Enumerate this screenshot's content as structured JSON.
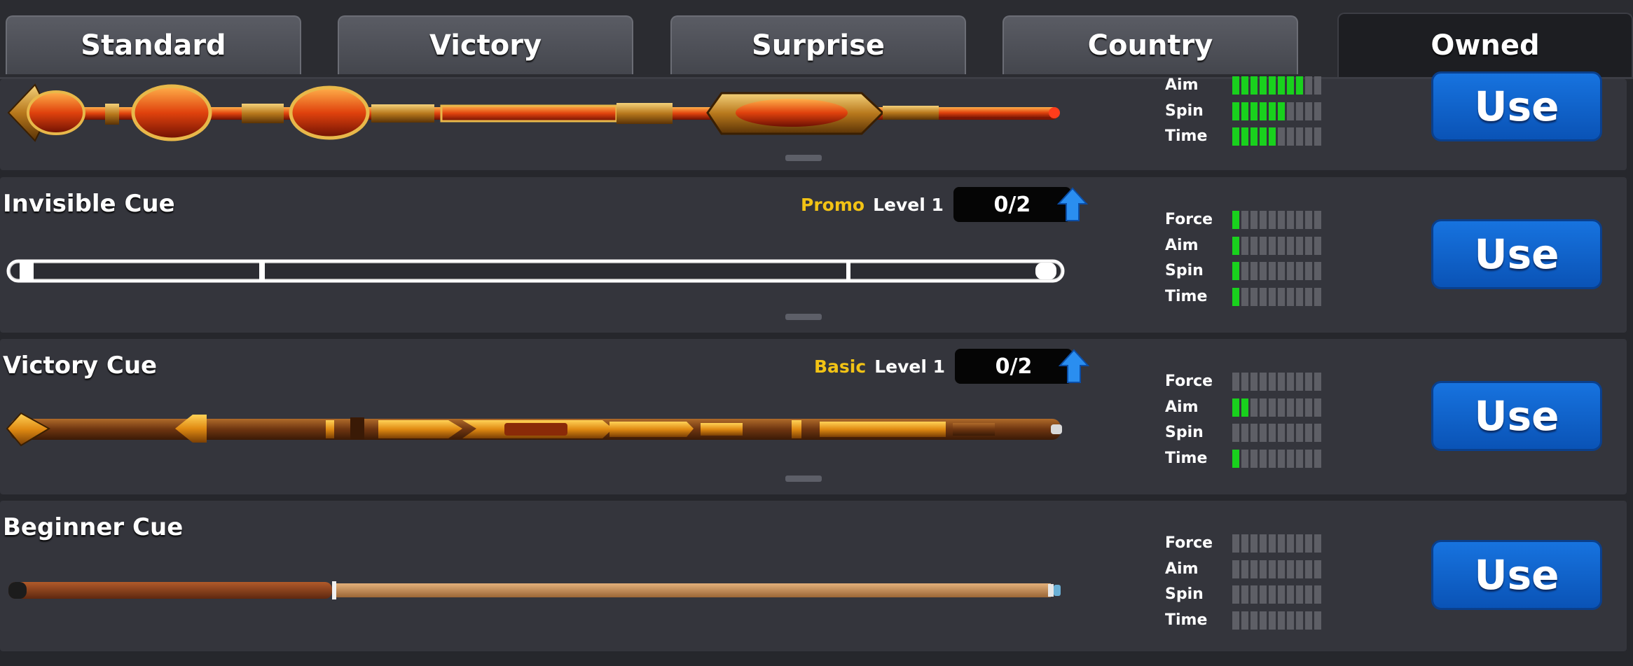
{
  "tabs": [
    {
      "label": "Standard",
      "active": false
    },
    {
      "label": "Victory",
      "active": false
    },
    {
      "label": "Surprise",
      "active": false
    },
    {
      "label": "Country",
      "active": false
    },
    {
      "label": "Owned",
      "active": true
    }
  ],
  "stat_max": 10,
  "cues": [
    {
      "name": "",
      "stats": [
        {
          "label": "Aim",
          "value": 8
        },
        {
          "label": "Spin",
          "value": 6
        },
        {
          "label": "Time",
          "value": 5
        }
      ],
      "button": "Use"
    },
    {
      "name": "Invisible Cue",
      "tier": "Promo",
      "level": "Level 1",
      "progress": "0/2",
      "stats": [
        {
          "label": "Force",
          "value": 1
        },
        {
          "label": "Aim",
          "value": 1
        },
        {
          "label": "Spin",
          "value": 1
        },
        {
          "label": "Time",
          "value": 1
        }
      ],
      "button": "Use"
    },
    {
      "name": "Victory Cue",
      "tier": "Basic",
      "level": "Level 1",
      "progress": "0/2",
      "stats": [
        {
          "label": "Force",
          "value": 0
        },
        {
          "label": "Aim",
          "value": 2
        },
        {
          "label": "Spin",
          "value": 0
        },
        {
          "label": "Time",
          "value": 1
        }
      ],
      "button": "Use"
    },
    {
      "name": "Beginner Cue",
      "stats": [
        {
          "label": "Force",
          "value": 0
        },
        {
          "label": "Aim",
          "value": 0
        },
        {
          "label": "Spin",
          "value": 0
        },
        {
          "label": "Time",
          "value": 0
        }
      ],
      "button": "Use"
    }
  ],
  "colors": {
    "stat_on": "#19d11d",
    "stat_off": "#5e5f66",
    "tier": "#f2c315",
    "button": "#1773df"
  }
}
